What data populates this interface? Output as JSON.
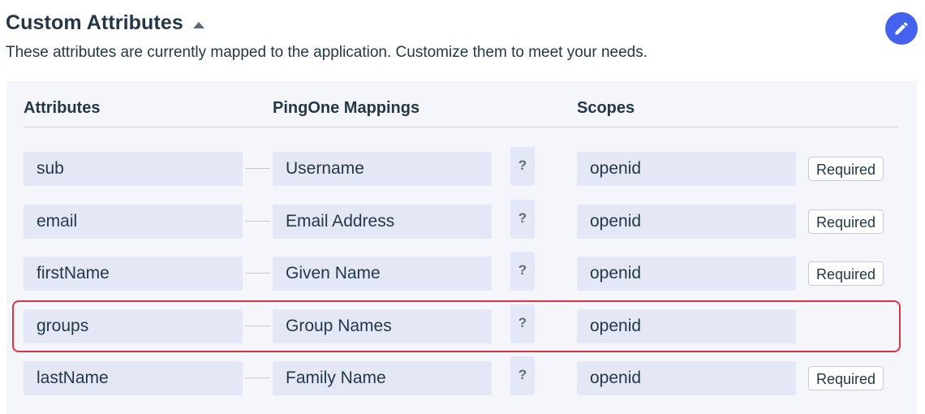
{
  "header": {
    "title": "Custom Attributes",
    "collapse_icon": "caret-up-icon",
    "edit_icon": "pencil-icon",
    "subtitle": "These attributes are currently mapped to the application. Customize them to meet your needs."
  },
  "columns": {
    "attributes": "Attributes",
    "mappings": "PingOne Mappings",
    "scopes": "Scopes"
  },
  "rows": [
    {
      "attribute": "sub",
      "mapping": "Username",
      "help": "?",
      "scope": "openid",
      "badge": "Required"
    },
    {
      "attribute": "email",
      "mapping": "Email Address",
      "help": "?",
      "scope": "openid",
      "badge": "Required"
    },
    {
      "attribute": "firstName",
      "mapping": "Given Name",
      "help": "?",
      "scope": "openid",
      "badge": "Required"
    },
    {
      "attribute": "groups",
      "mapping": "Group Names",
      "help": "?",
      "scope": "openid",
      "highlighted": true
    },
    {
      "attribute": "lastName",
      "mapping": "Family Name",
      "help": "?",
      "scope": "openid",
      "badge": "Required"
    }
  ],
  "colors": {
    "accent": "#4462ed",
    "highlight": "#e03141",
    "field_bg": "#e4e8f6",
    "panel_bg": "#f5f6fb"
  }
}
